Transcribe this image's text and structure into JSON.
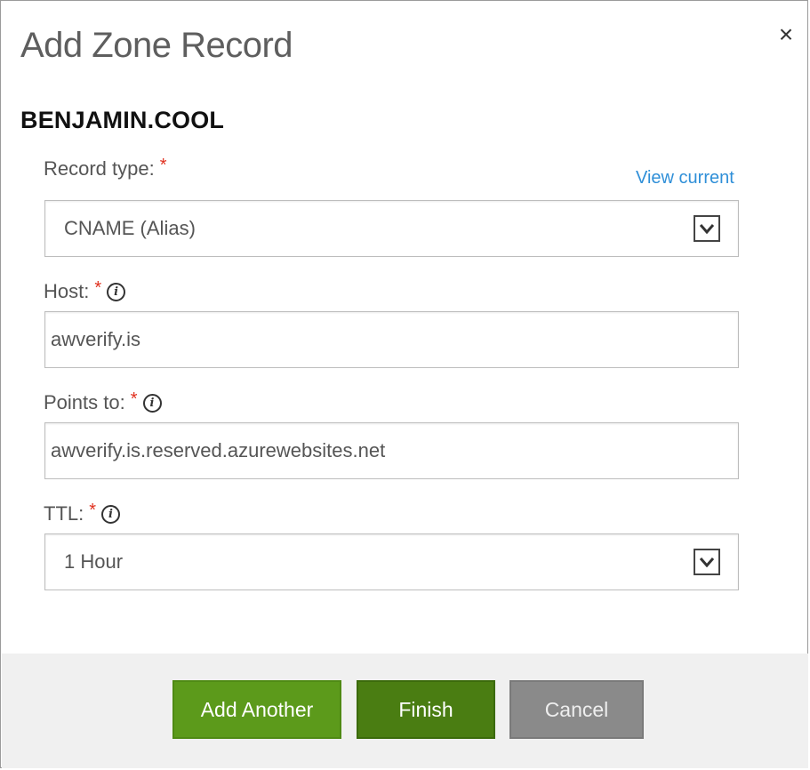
{
  "dialog": {
    "title": "Add Zone Record",
    "close_label": "×",
    "domain": "BENJAMIN.COOL"
  },
  "form": {
    "record_type": {
      "label": "Record type:",
      "required_mark": "*",
      "view_current": "View current",
      "value": "CNAME (Alias)"
    },
    "host": {
      "label": "Host:",
      "required_mark": "*",
      "value": "awverify.is"
    },
    "points_to": {
      "label": "Points to:",
      "required_mark": "*",
      "value": "awverify.is.reserved.azurewebsites.net"
    },
    "ttl": {
      "label": "TTL:",
      "required_mark": "*",
      "value": "1 Hour"
    },
    "info_icon": "i"
  },
  "footer": {
    "add_another": "Add Another",
    "finish": "Finish",
    "cancel": "Cancel"
  },
  "colors": {
    "required": "#e0301e",
    "link": "#2f8fd8",
    "add_another_bg": "#5c9a1b",
    "finish_bg": "#4a7d12",
    "cancel_bg": "#8a8a8a",
    "footer_bg": "#f0f0f0"
  }
}
